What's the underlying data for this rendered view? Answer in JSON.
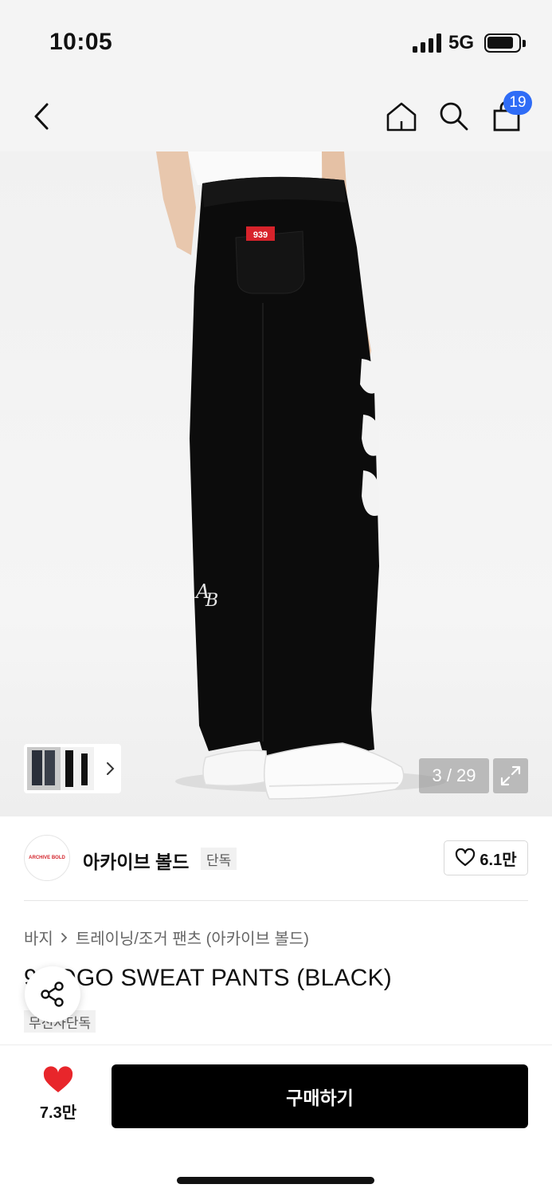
{
  "status_bar": {
    "time": "10:05",
    "network": "5G",
    "icons": [
      "signal-icon",
      "battery-icon"
    ]
  },
  "nav": {
    "icons": [
      "back-arrow-icon",
      "home-icon",
      "search-icon",
      "shopping-bag-icon"
    ],
    "cart_count": "19"
  },
  "gallery": {
    "counter": "3 / 29",
    "current_image": 3,
    "total_images": 29,
    "patch_text": "939",
    "icons": [
      "chevron-right-icon",
      "expand-icon"
    ]
  },
  "brand": {
    "logo_text": "ARCHIVE BOLD",
    "name": "아카이브 볼드",
    "tag": "단독",
    "likes": "6.1만",
    "icons": [
      "heart-outline-icon"
    ]
  },
  "breadcrumb": {
    "category": "바지",
    "subcategory": "트레이닝/조거 팬츠 (아카이브 볼드)"
  },
  "product": {
    "title": "9     LOGO SWEAT PANTS (BLACK)",
    "tag": "무신사단독"
  },
  "bottom": {
    "wish_count": "7.3만",
    "buy_label": "구매하기",
    "accent_color": "#e8262b",
    "icons": [
      "heart-filled-icon",
      "share-icon"
    ]
  }
}
